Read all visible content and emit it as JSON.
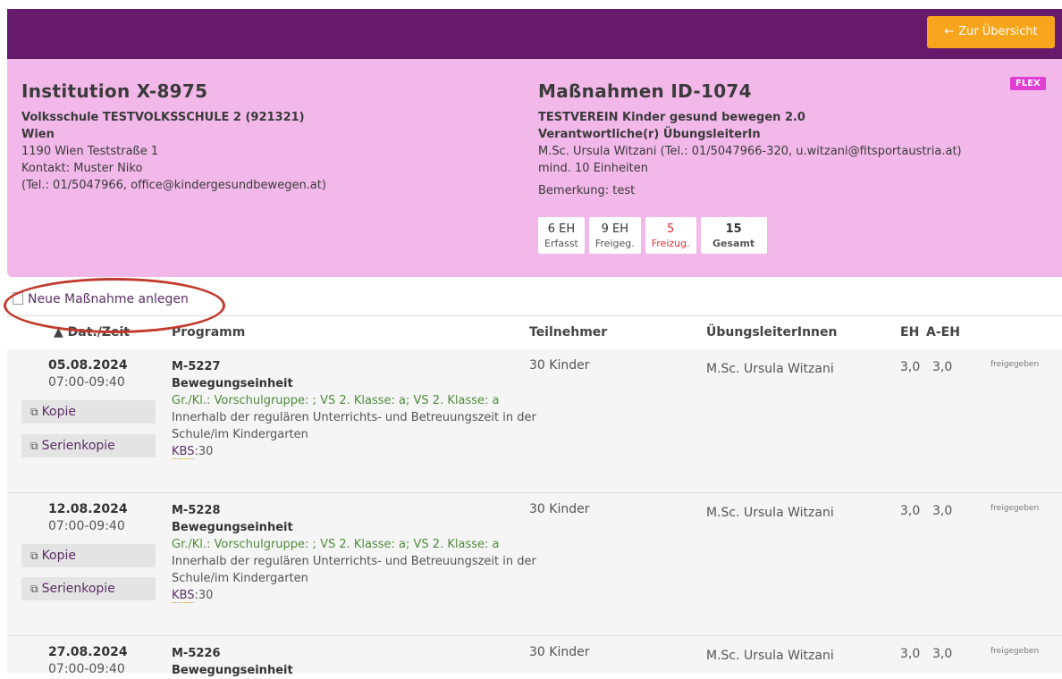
{
  "header": {
    "back_label": "Zur Übersicht"
  },
  "institution": {
    "title": "Institution X-8975",
    "school": "Volksschule TESTVOLKSSCHULE 2 (921321)",
    "region": "Wien",
    "address": "1190 Wien Teststraße 1",
    "contact": "Kontakt: Muster Niko",
    "contact_details": "(Tel.: 01/5047966, office@kindergesundbewegen.at)"
  },
  "measure": {
    "title": "Maßnahmen ID-1074",
    "badge": "FLEX",
    "association": "TESTVEREIN Kinder gesund bewegen 2.0",
    "trainer_heading": "Verantwortliche(r) ÜbungsleiterIn",
    "trainer_details": "M.Sc. Ursula Witzani (Tel.: 01/5047966-320, u.witzani@fitsportaustria.at)",
    "min_units": "mind. 10 Einheiten",
    "remark": "Bemerkung: test",
    "stats": [
      {
        "value": "6 EH",
        "label": "Erfasst",
        "style": "normal"
      },
      {
        "value": "9 EH",
        "label": "Freigeg.",
        "style": "normal"
      },
      {
        "value": "5",
        "label": "Freizug.",
        "style": "red"
      },
      {
        "value": "15",
        "label": "Gesamt",
        "style": "bold"
      }
    ]
  },
  "new_measure_label": "Neue Maßnahme anlegen",
  "table": {
    "headers": {
      "date": "▲ Dat./Zeit",
      "program": "Programm",
      "participants": "Teilnehmer",
      "trainers": "ÜbungsleiterInnen",
      "eh": "EH",
      "aeh": "A-EH"
    },
    "copy_label": "Kopie",
    "series_copy_label": "Serienkopie",
    "rows": [
      {
        "date": "05.08.2024",
        "time": "07:00-09:40",
        "code": "M-5227",
        "title": "Bewegungseinheit",
        "groups": "Gr./Kl.: Vorschulgruppe: ; VS 2. Klasse: a; VS 2. Klasse: a",
        "description": "Innerhalb der regulären Unterrichts- und Betreuungszeit in der Schule/im Kindergarten",
        "kbs_label": "KBS",
        "kbs_value": ":30",
        "participants": "30 Kinder",
        "trainer": "M.Sc. Ursula Witzani",
        "eh": "3,0",
        "aeh": "3,0",
        "status": "freigegeben"
      },
      {
        "date": "12.08.2024",
        "time": "07:00-09:40",
        "code": "M-5228",
        "title": "Bewegungseinheit",
        "groups": "Gr./Kl.: Vorschulgruppe: ; VS 2. Klasse: a; VS 2. Klasse: a",
        "description": "Innerhalb der regulären Unterrichts- und Betreuungszeit in der Schule/im Kindergarten",
        "kbs_label": "KBS",
        "kbs_value": ":30",
        "participants": "30 Kinder",
        "trainer": "M.Sc. Ursula Witzani",
        "eh": "3,0",
        "aeh": "3,0",
        "status": "freigegeben"
      },
      {
        "date": "27.08.2024",
        "time": "07:00-09:40",
        "code": "M-5226",
        "title": "Bewegungseinheit",
        "groups": "",
        "description": "",
        "kbs_label": "",
        "kbs_value": "",
        "participants": "30 Kinder",
        "trainer": "M.Sc. Ursula Witzani",
        "eh": "3,0",
        "aeh": "3,0",
        "status": "freigegeben"
      }
    ]
  }
}
